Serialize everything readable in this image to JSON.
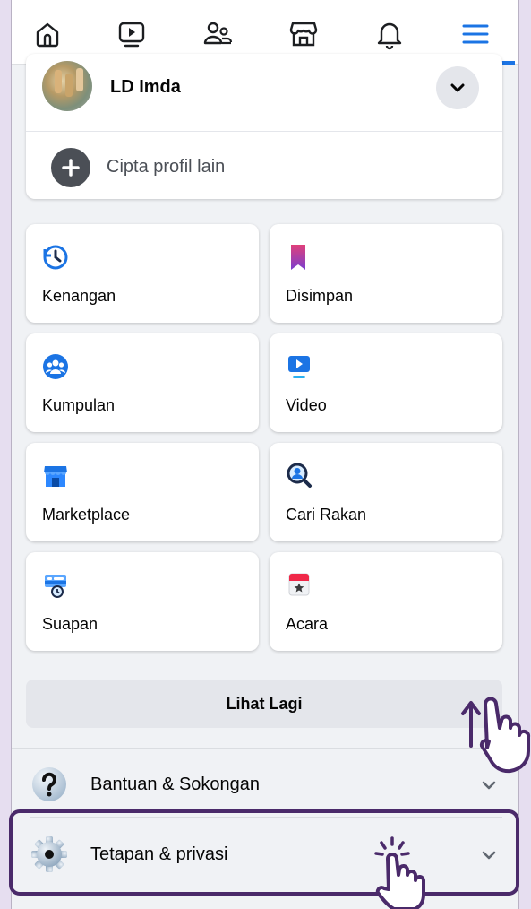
{
  "nav": {
    "items": [
      "home-icon",
      "video-icon",
      "friends-icon",
      "marketplace-icon",
      "notifications-icon",
      "menu-icon"
    ],
    "active_color": "#1b74e4"
  },
  "profile": {
    "name": "LD Imda",
    "create_profile_label": "Cipta profil lain"
  },
  "shortcuts": [
    {
      "label": "Kenangan",
      "icon": "memories-icon"
    },
    {
      "label": "Disimpan",
      "icon": "saved-icon"
    },
    {
      "label": "Kumpulan",
      "icon": "groups-icon"
    },
    {
      "label": "Video",
      "icon": "video-tile-icon"
    },
    {
      "label": "Marketplace",
      "icon": "marketplace-tile-icon"
    },
    {
      "label": "Cari Rakan",
      "icon": "find-friends-icon"
    },
    {
      "label": "Suapan",
      "icon": "feeds-icon"
    },
    {
      "label": "Acara",
      "icon": "events-icon"
    }
  ],
  "see_more_label": "Lihat Lagi",
  "menu_rows": [
    {
      "label": "Bantuan & Sokongan",
      "icon": "help-icon"
    },
    {
      "label": "Tetapan & privasi",
      "icon": "settings-gear-icon"
    }
  ],
  "annotation_color": "#4a2a6a"
}
